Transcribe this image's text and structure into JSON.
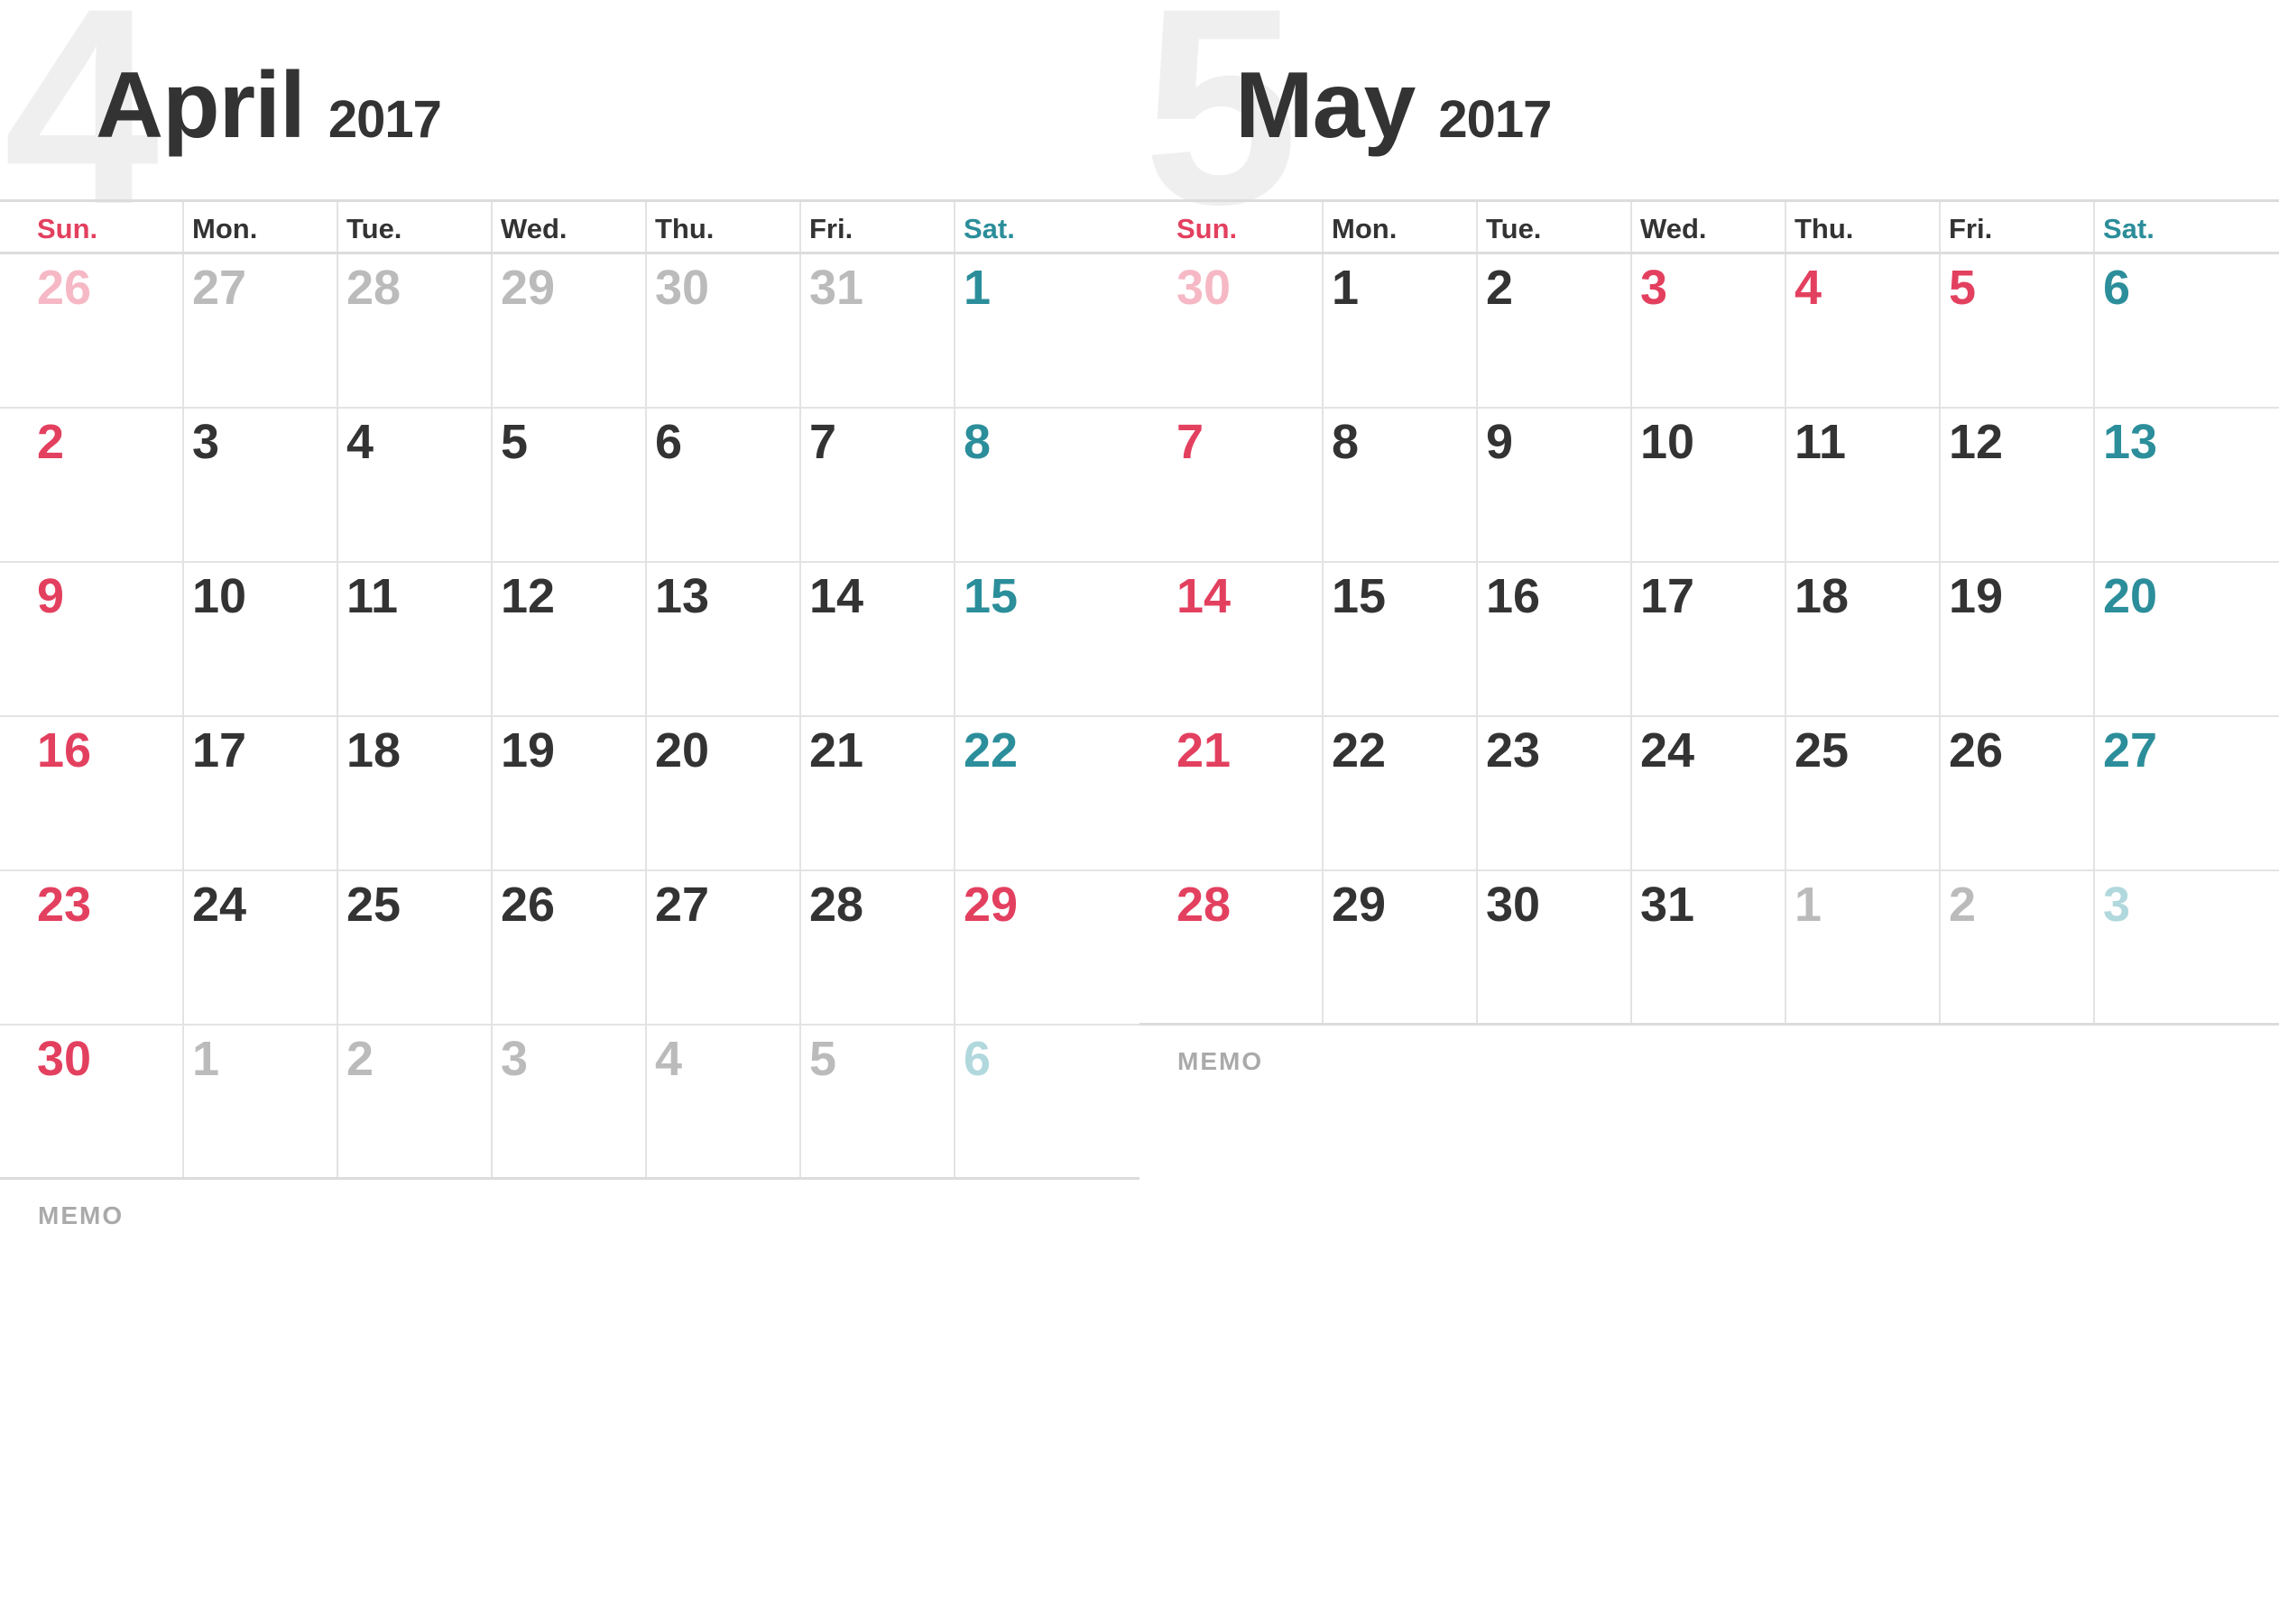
{
  "calendars": [
    {
      "month_number": "4",
      "month_name": "April",
      "year": "2017",
      "weekdays": [
        {
          "label": "Sun.",
          "color": "#e3405f"
        },
        {
          "label": "Mon.",
          "color": "#333333"
        },
        {
          "label": "Tue.",
          "color": "#333333"
        },
        {
          "label": "Wed.",
          "color": "#333333"
        },
        {
          "label": "Thu.",
          "color": "#333333"
        },
        {
          "label": "Fri.",
          "color": "#333333"
        },
        {
          "label": "Sat.",
          "color": "#2b8e9a"
        }
      ],
      "weeks": [
        [
          {
            "day": "26",
            "color": "#f5b8c4"
          },
          {
            "day": "27",
            "color": "#bbbbbb"
          },
          {
            "day": "28",
            "color": "#bbbbbb"
          },
          {
            "day": "29",
            "color": "#bbbbbb"
          },
          {
            "day": "30",
            "color": "#bbbbbb"
          },
          {
            "day": "31",
            "color": "#bbbbbb"
          },
          {
            "day": "1",
            "color": "#2b8e9a"
          }
        ],
        [
          {
            "day": "2",
            "color": "#e3405f"
          },
          {
            "day": "3",
            "color": "#333333"
          },
          {
            "day": "4",
            "color": "#333333"
          },
          {
            "day": "5",
            "color": "#333333"
          },
          {
            "day": "6",
            "color": "#333333"
          },
          {
            "day": "7",
            "color": "#333333"
          },
          {
            "day": "8",
            "color": "#2b8e9a"
          }
        ],
        [
          {
            "day": "9",
            "color": "#e3405f"
          },
          {
            "day": "10",
            "color": "#333333"
          },
          {
            "day": "11",
            "color": "#333333"
          },
          {
            "day": "12",
            "color": "#333333"
          },
          {
            "day": "13",
            "color": "#333333"
          },
          {
            "day": "14",
            "color": "#333333"
          },
          {
            "day": "15",
            "color": "#2b8e9a"
          }
        ],
        [
          {
            "day": "16",
            "color": "#e3405f"
          },
          {
            "day": "17",
            "color": "#333333"
          },
          {
            "day": "18",
            "color": "#333333"
          },
          {
            "day": "19",
            "color": "#333333"
          },
          {
            "day": "20",
            "color": "#333333"
          },
          {
            "day": "21",
            "color": "#333333"
          },
          {
            "day": "22",
            "color": "#2b8e9a"
          }
        ],
        [
          {
            "day": "23",
            "color": "#e3405f"
          },
          {
            "day": "24",
            "color": "#333333"
          },
          {
            "day": "25",
            "color": "#333333"
          },
          {
            "day": "26",
            "color": "#333333"
          },
          {
            "day": "27",
            "color": "#333333"
          },
          {
            "day": "28",
            "color": "#333333"
          },
          {
            "day": "29",
            "color": "#e3405f"
          }
        ],
        [
          {
            "day": "30",
            "color": "#e3405f"
          },
          {
            "day": "1",
            "color": "#bbbbbb"
          },
          {
            "day": "2",
            "color": "#bbbbbb"
          },
          {
            "day": "3",
            "color": "#bbbbbb"
          },
          {
            "day": "4",
            "color": "#bbbbbb"
          },
          {
            "day": "5",
            "color": "#bbbbbb"
          },
          {
            "day": "6",
            "color": "#b0d8dd"
          }
        ]
      ],
      "memo_label": "MEMO"
    },
    {
      "month_number": "5",
      "month_name": "May",
      "year": "2017",
      "weekdays": [
        {
          "label": "Sun.",
          "color": "#e3405f"
        },
        {
          "label": "Mon.",
          "color": "#333333"
        },
        {
          "label": "Tue.",
          "color": "#333333"
        },
        {
          "label": "Wed.",
          "color": "#333333"
        },
        {
          "label": "Thu.",
          "color": "#333333"
        },
        {
          "label": "Fri.",
          "color": "#333333"
        },
        {
          "label": "Sat.",
          "color": "#2b8e9a"
        }
      ],
      "weeks": [
        [
          {
            "day": "30",
            "color": "#f5b8c4"
          },
          {
            "day": "1",
            "color": "#333333"
          },
          {
            "day": "2",
            "color": "#333333"
          },
          {
            "day": "3",
            "color": "#e3405f"
          },
          {
            "day": "4",
            "color": "#e3405f"
          },
          {
            "day": "5",
            "color": "#e3405f"
          },
          {
            "day": "6",
            "color": "#2b8e9a"
          }
        ],
        [
          {
            "day": "7",
            "color": "#e3405f"
          },
          {
            "day": "8",
            "color": "#333333"
          },
          {
            "day": "9",
            "color": "#333333"
          },
          {
            "day": "10",
            "color": "#333333"
          },
          {
            "day": "11",
            "color": "#333333"
          },
          {
            "day": "12",
            "color": "#333333"
          },
          {
            "day": "13",
            "color": "#2b8e9a"
          }
        ],
        [
          {
            "day": "14",
            "color": "#e3405f"
          },
          {
            "day": "15",
            "color": "#333333"
          },
          {
            "day": "16",
            "color": "#333333"
          },
          {
            "day": "17",
            "color": "#333333"
          },
          {
            "day": "18",
            "color": "#333333"
          },
          {
            "day": "19",
            "color": "#333333"
          },
          {
            "day": "20",
            "color": "#2b8e9a"
          }
        ],
        [
          {
            "day": "21",
            "color": "#e3405f"
          },
          {
            "day": "22",
            "color": "#333333"
          },
          {
            "day": "23",
            "color": "#333333"
          },
          {
            "day": "24",
            "color": "#333333"
          },
          {
            "day": "25",
            "color": "#333333"
          },
          {
            "day": "26",
            "color": "#333333"
          },
          {
            "day": "27",
            "color": "#2b8e9a"
          }
        ],
        [
          {
            "day": "28",
            "color": "#e3405f"
          },
          {
            "day": "29",
            "color": "#333333"
          },
          {
            "day": "30",
            "color": "#333333"
          },
          {
            "day": "31",
            "color": "#333333"
          },
          {
            "day": "1",
            "color": "#bbbbbb"
          },
          {
            "day": "2",
            "color": "#bbbbbb"
          },
          {
            "day": "3",
            "color": "#b0d8dd"
          }
        ]
      ],
      "memo_label": "MEMO"
    }
  ]
}
